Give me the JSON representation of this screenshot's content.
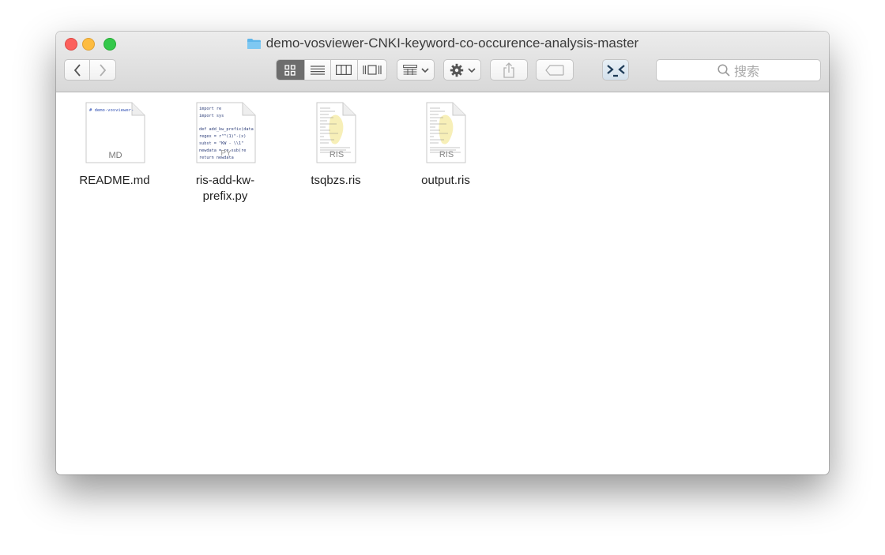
{
  "window": {
    "title": "demo-vosviewer-CNKI-keyword-co-occurence-analysis-master"
  },
  "toolbar": {
    "back_icon": "chevron-left-icon",
    "forward_icon": "chevron-right-icon",
    "view_modes": [
      "icon-view",
      "list-view",
      "column-view",
      "cover-flow-view"
    ],
    "active_view": "icon-view",
    "search_placeholder": "搜索"
  },
  "files": [
    {
      "name": "README.md",
      "type": "md",
      "badge": "MD",
      "preview": "# demo-vosviewer-"
    },
    {
      "name": "ris-add-kw-prefix.py",
      "line1": "ris-add-kw-",
      "line2": "prefix.py",
      "type": "py",
      "badge": "PY",
      "preview_lines": [
        "import re",
        "import sys",
        "",
        "def add_kw_prefix(data",
        "    regex = r\"^(1)\"-(x)",
        "    subst = \"KW  - \\\\1\"",
        "    newdata = re.sub(re",
        "    return newdata"
      ]
    },
    {
      "name": "tsqbzs.ris",
      "type": "ris",
      "badge": "RIS"
    },
    {
      "name": "output.ris",
      "type": "ris",
      "badge": "RIS"
    }
  ]
}
